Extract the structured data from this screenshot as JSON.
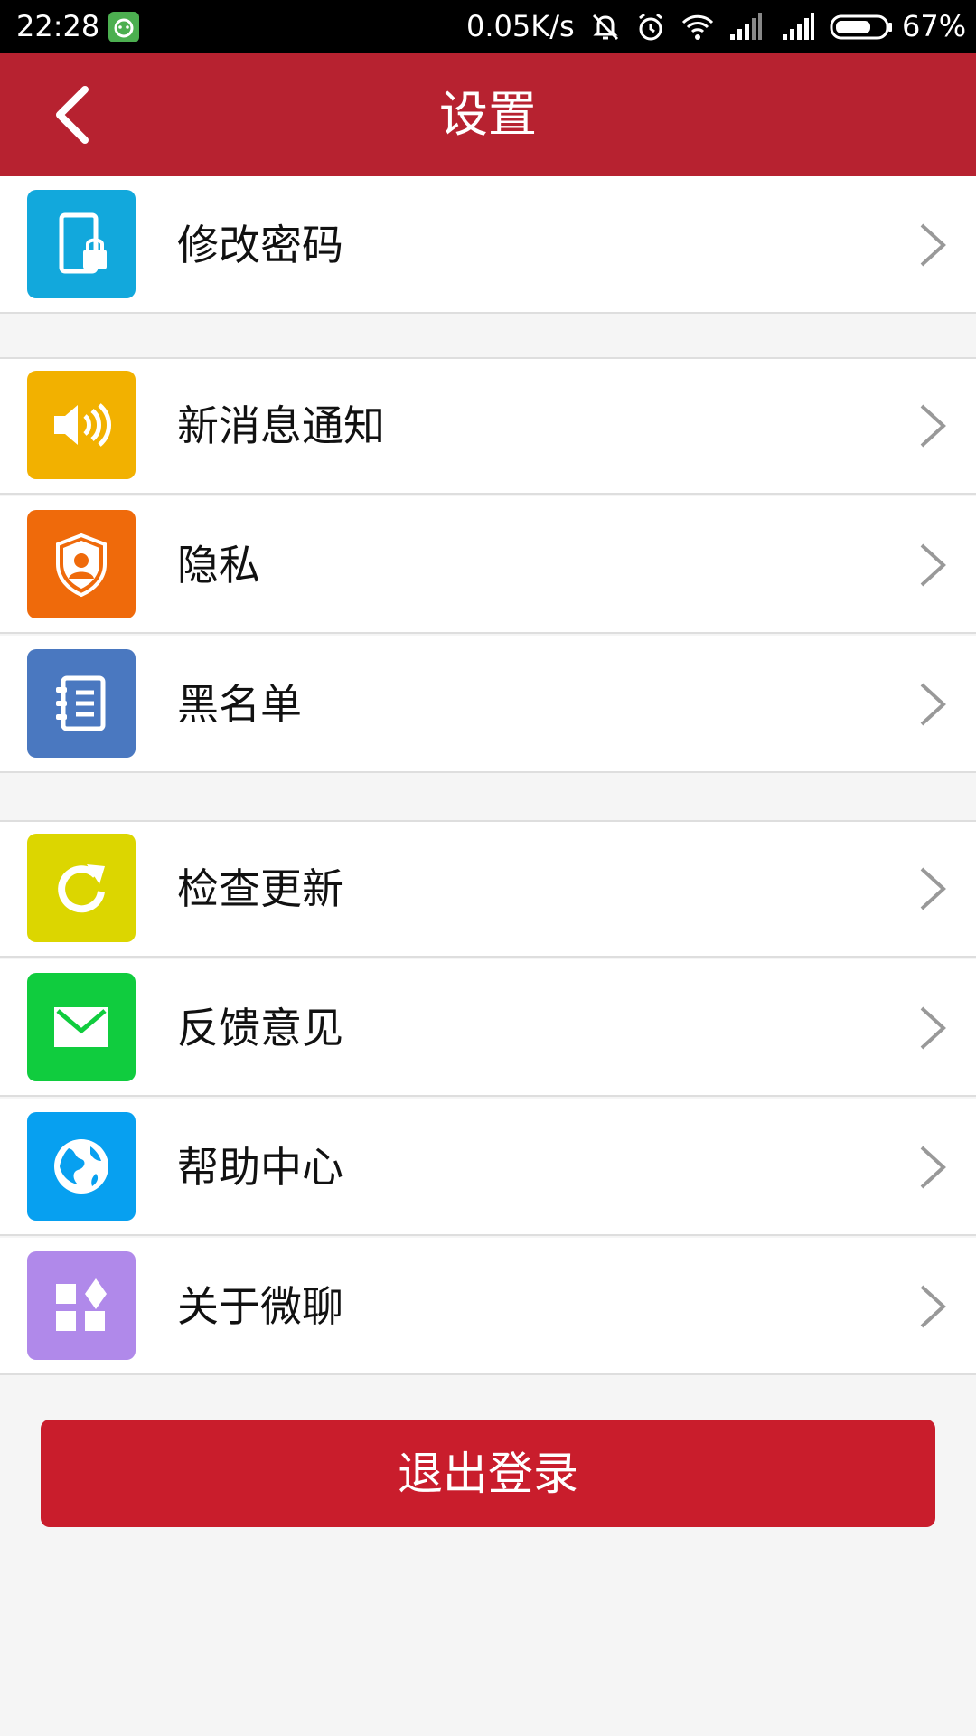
{
  "status_bar": {
    "time": "22:28",
    "network_speed": "0.05K/s",
    "battery_percent": "67%",
    "icons": [
      "notification-app-icon",
      "mute-icon",
      "alarm-icon",
      "wifi-icon",
      "signal-icon",
      "signal-icon",
      "battery-icon"
    ]
  },
  "app_bar": {
    "title": "设置",
    "back_icon": "back-arrow-icon"
  },
  "colors": {
    "app_bar": "#b72230",
    "logout_button": "#c91d2c",
    "background": "#f5f5f5"
  },
  "settings": {
    "items": [
      {
        "label": "修改密码",
        "icon": "phone-lock-icon",
        "color": "#12a8dc"
      },
      {
        "label": "新消息通知",
        "icon": "speaker-icon",
        "color": "#f2b100"
      },
      {
        "label": "隐私",
        "icon": "shield-user-icon",
        "color": "#ef6a0b"
      },
      {
        "label": "黑名单",
        "icon": "contact-book-icon",
        "color": "#4a78c0"
      },
      {
        "label": "检查更新",
        "icon": "refresh-icon",
        "color": "#dcd600"
      },
      {
        "label": "反馈意见",
        "icon": "mail-icon",
        "color": "#10cc3e"
      },
      {
        "label": "帮助中心",
        "icon": "globe-icon",
        "color": "#07a0f0"
      },
      {
        "label": "关于微聊",
        "icon": "apps-icon",
        "color": "#b089ea"
      }
    ]
  },
  "logout": {
    "label": "退出登录"
  }
}
